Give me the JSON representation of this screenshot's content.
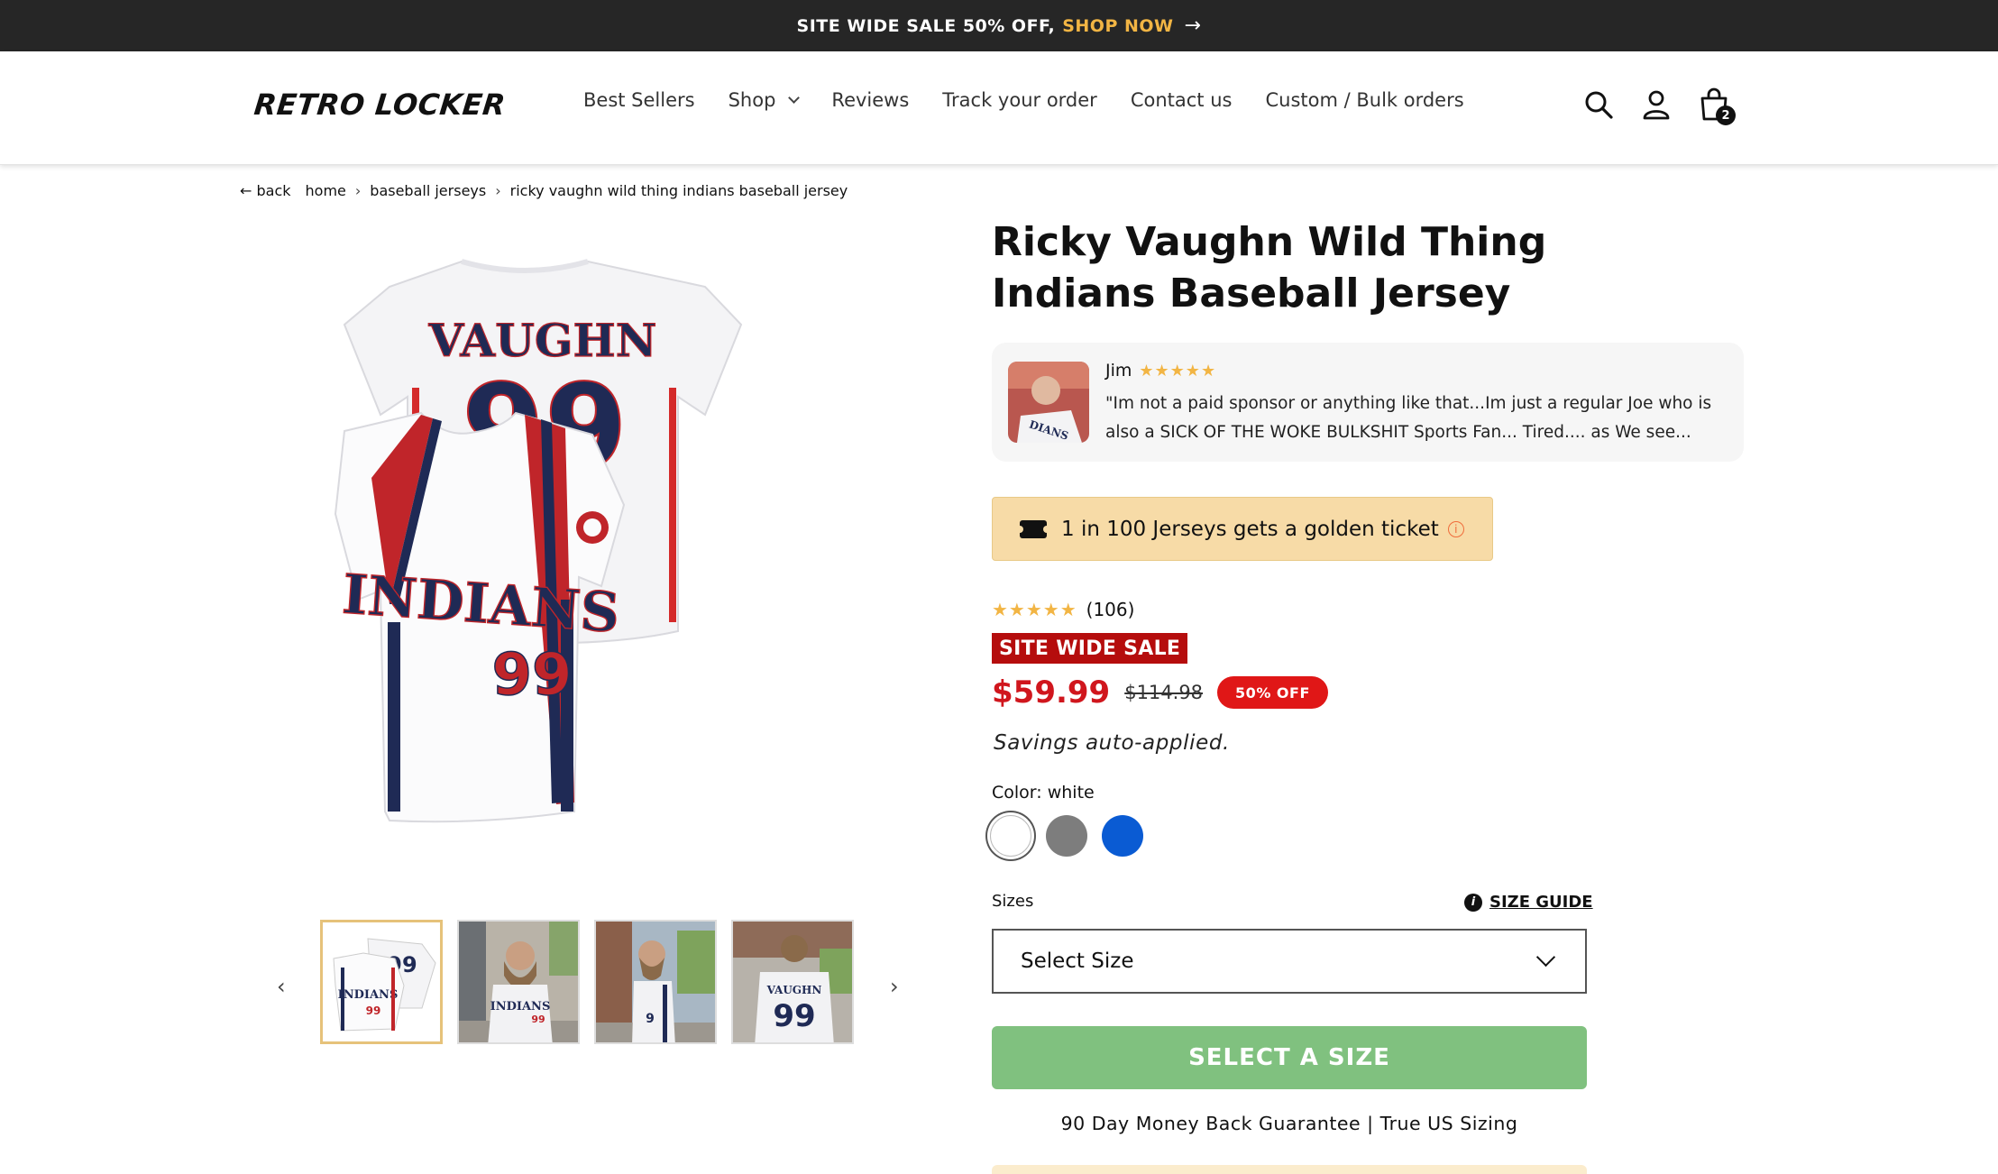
{
  "announcement": {
    "text": "SITE WIDE SALE 50% OFF,",
    "link": "SHOP NOW",
    "arrow": "→"
  },
  "header": {
    "logo": "RETRO LOCKER",
    "nav": [
      "Best Sellers",
      "Shop",
      "Reviews",
      "Track your order",
      "Contact us",
      "Custom / Bulk orders"
    ],
    "cart_count": "2",
    "icons": [
      "search-icon",
      "account-icon",
      "cart-icon"
    ]
  },
  "breadcrumb": {
    "back": "← back",
    "items": [
      "home",
      "baseball jerseys",
      "ricky vaughn wild thing indians baseball jersey"
    ],
    "separator": "›"
  },
  "gallery": {
    "prev": "‹",
    "next": "›",
    "main_jersey": {
      "back_name": "VAUGHN",
      "number": "99",
      "front_team": "INDIANS"
    },
    "thumbnails": 4,
    "active_thumbnail": 1
  },
  "product": {
    "title": "Ricky Vaughn Wild Thing Indians Baseball Jersey",
    "review": {
      "name": "Jim",
      "stars": "★★★★★",
      "text": "\"Im not a paid sponsor or anything like that...Im just a regular Joe who is also a SICK OF THE WOKE BULKSHIT Sports Fan... Tired.... as We see..."
    },
    "golden_ticket": {
      "text": "1 in 100 Jerseys gets a golden ticket",
      "info": "i"
    },
    "rating": {
      "stars": "★★★★★",
      "count": "(106)"
    },
    "sale_badge": "SITE WIDE SALE",
    "price": {
      "now": "$59.99",
      "was": "$114.98",
      "off": "50% OFF"
    },
    "savings": "Savings auto-applied.",
    "color_label": "Color: white",
    "colors": [
      "#ffffff",
      "#7d7d7d",
      "#0a5bd3"
    ],
    "sizes_label": "Sizes",
    "size_guide": "SIZE GUIDE",
    "size_select": "Select Size",
    "cta": "SELECT A SIZE",
    "guarantee": "90 Day Money Back Guarantee | True US Sizing"
  },
  "colors": {
    "announce_bg": "#262626",
    "accent_gold": "#f2b544",
    "sale_red": "#b50d0d",
    "price_red": "#d0161d",
    "cta_green": "#80c17f",
    "golden_bg": "#f7dba7"
  }
}
